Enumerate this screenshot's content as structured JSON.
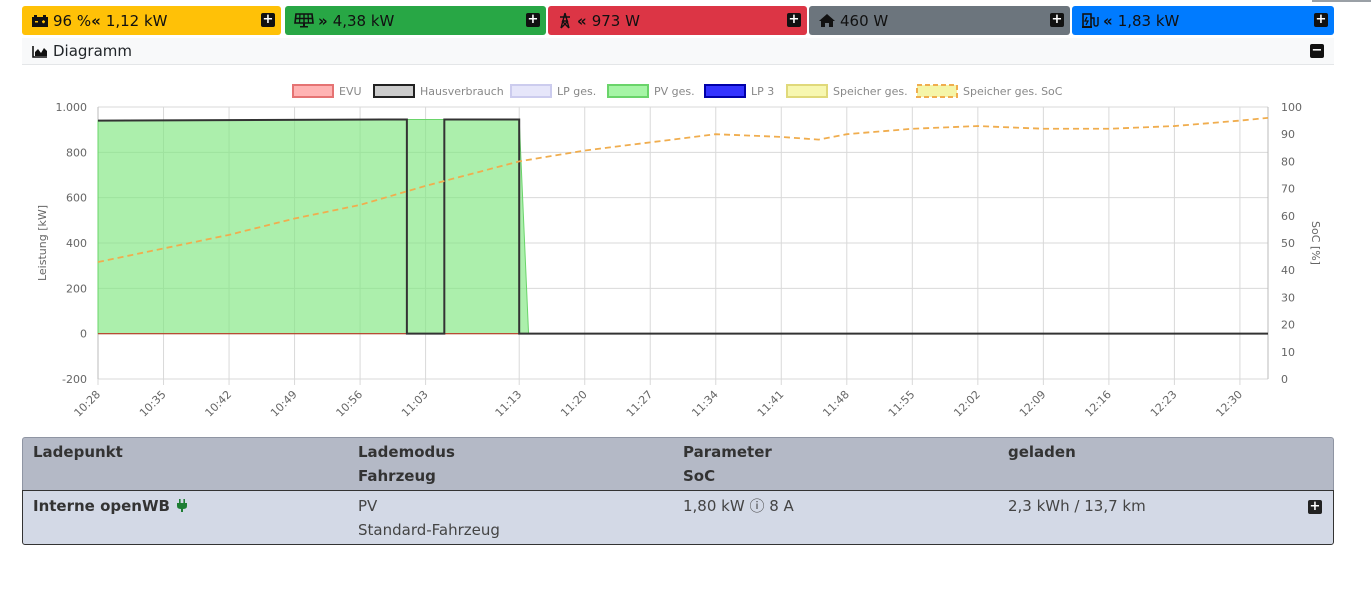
{
  "tiles": {
    "battery": {
      "value": "96 % ",
      "dir": "«",
      "power": "1,12 kW"
    },
    "pv": {
      "dir": "»",
      "power": "4,38 kW"
    },
    "grid": {
      "dir": "«",
      "power": "973 W"
    },
    "house": {
      "power": "460 W"
    },
    "chargepoint": {
      "dir": "«",
      "power": "1,83 kW"
    }
  },
  "diagram": {
    "title": "Diagramm"
  },
  "chart_data": {
    "type": "area",
    "legend": [
      "EVU",
      "Hausverbrauch",
      "LP ges.",
      "PV ges.",
      "LP 3",
      "Speicher ges.",
      "Speicher ges. SoC"
    ],
    "legend_position": "top",
    "ylabel": "Leistung [kW]",
    "y2label": "SoC [%]",
    "ylim": [
      -200,
      1000
    ],
    "y2lim": [
      0,
      100
    ],
    "yticks": [
      "1.000",
      "800",
      "600",
      "400",
      "200",
      "0",
      "-200"
    ],
    "y2ticks": [
      "100",
      "90",
      "80",
      "70",
      "60",
      "50",
      "40",
      "30",
      "20",
      "10",
      "0"
    ],
    "xticks": [
      "10:28",
      "10:35",
      "10:42",
      "10:49",
      "10:56",
      "11:03",
      "11:13",
      "11:20",
      "11:27",
      "11:34",
      "11:41",
      "11:48",
      "11:55",
      "12:02",
      "12:09",
      "12:16",
      "12:23",
      "12:30"
    ],
    "grid": true,
    "series": [
      {
        "name": "PV ges.",
        "color": "#7fe67f",
        "x": [
          "10:28",
          "11:01",
          "11:02",
          "11:05",
          "11:06",
          "11:13",
          "11:14",
          "12:33"
        ],
        "values": [
          940,
          945,
          945,
          945,
          945,
          945,
          0,
          0
        ]
      },
      {
        "name": "Hausverbrauch",
        "color": "#333333",
        "x": [
          "10:28",
          "11:01",
          "11:01",
          "11:05",
          "11:05",
          "11:13",
          "11:13",
          "12:33"
        ],
        "values": [
          940,
          945,
          0,
          0,
          945,
          945,
          0,
          0
        ]
      },
      {
        "name": "EVU",
        "color": "#ff8080",
        "x": [
          "10:28",
          "12:33"
        ],
        "values": [
          0,
          0
        ]
      },
      {
        "name": "Speicher ges. SoC",
        "color": "#f0ad4e",
        "x": [
          "10:28",
          "10:35",
          "10:42",
          "10:49",
          "10:56",
          "11:03",
          "11:13",
          "11:20",
          "11:27",
          "11:34",
          "11:41",
          "11:45",
          "11:48",
          "11:55",
          "12:02",
          "12:09",
          "12:16",
          "12:23",
          "12:30",
          "12:33"
        ],
        "values": [
          43,
          48,
          53,
          59,
          64,
          71,
          80,
          84,
          87,
          90,
          89,
          88,
          90,
          92,
          93,
          92,
          92,
          93,
          95,
          96
        ]
      }
    ]
  },
  "table": {
    "headers": {
      "c1": "Ladepunkt",
      "c2a": "Lademodus",
      "c2b": "Fahrzeug",
      "c3a": "Parameter",
      "c3b": "SoC",
      "c4": "geladen"
    },
    "row": {
      "name": "Interne openWB",
      "mode": "PV",
      "vehicle": "Standard-Fahrzeug",
      "params": "1,80 kW ⓘ 8 A",
      "charged": "2,3 kWh / 13,7 km"
    }
  }
}
